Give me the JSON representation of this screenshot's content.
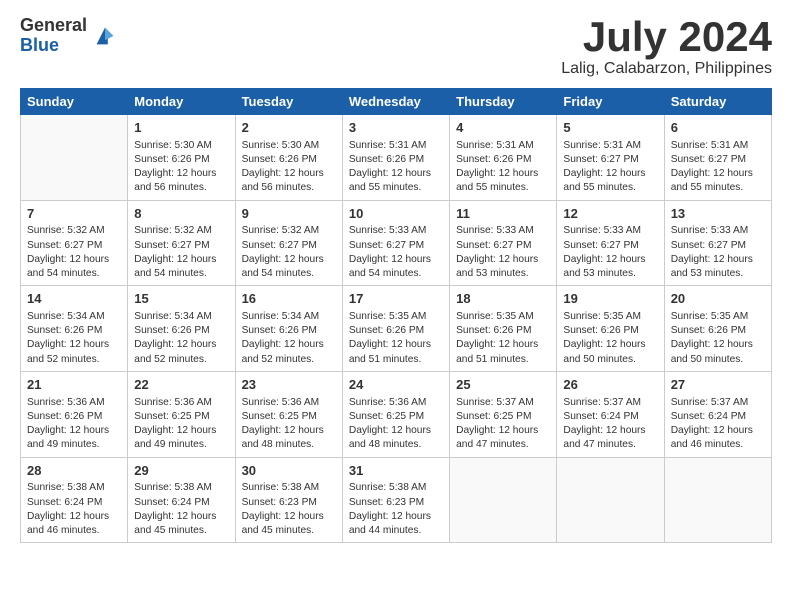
{
  "logo": {
    "general": "General",
    "blue": "Blue"
  },
  "title": "July 2024",
  "location": "Lalig, Calabarzon, Philippines",
  "headers": [
    "Sunday",
    "Monday",
    "Tuesday",
    "Wednesday",
    "Thursday",
    "Friday",
    "Saturday"
  ],
  "weeks": [
    [
      {
        "day": "",
        "info": ""
      },
      {
        "day": "1",
        "info": "Sunrise: 5:30 AM\nSunset: 6:26 PM\nDaylight: 12 hours\nand 56 minutes."
      },
      {
        "day": "2",
        "info": "Sunrise: 5:30 AM\nSunset: 6:26 PM\nDaylight: 12 hours\nand 56 minutes."
      },
      {
        "day": "3",
        "info": "Sunrise: 5:31 AM\nSunset: 6:26 PM\nDaylight: 12 hours\nand 55 minutes."
      },
      {
        "day": "4",
        "info": "Sunrise: 5:31 AM\nSunset: 6:26 PM\nDaylight: 12 hours\nand 55 minutes."
      },
      {
        "day": "5",
        "info": "Sunrise: 5:31 AM\nSunset: 6:27 PM\nDaylight: 12 hours\nand 55 minutes."
      },
      {
        "day": "6",
        "info": "Sunrise: 5:31 AM\nSunset: 6:27 PM\nDaylight: 12 hours\nand 55 minutes."
      }
    ],
    [
      {
        "day": "7",
        "info": "Sunrise: 5:32 AM\nSunset: 6:27 PM\nDaylight: 12 hours\nand 54 minutes."
      },
      {
        "day": "8",
        "info": "Sunrise: 5:32 AM\nSunset: 6:27 PM\nDaylight: 12 hours\nand 54 minutes."
      },
      {
        "day": "9",
        "info": "Sunrise: 5:32 AM\nSunset: 6:27 PM\nDaylight: 12 hours\nand 54 minutes."
      },
      {
        "day": "10",
        "info": "Sunrise: 5:33 AM\nSunset: 6:27 PM\nDaylight: 12 hours\nand 54 minutes."
      },
      {
        "day": "11",
        "info": "Sunrise: 5:33 AM\nSunset: 6:27 PM\nDaylight: 12 hours\nand 53 minutes."
      },
      {
        "day": "12",
        "info": "Sunrise: 5:33 AM\nSunset: 6:27 PM\nDaylight: 12 hours\nand 53 minutes."
      },
      {
        "day": "13",
        "info": "Sunrise: 5:33 AM\nSunset: 6:27 PM\nDaylight: 12 hours\nand 53 minutes."
      }
    ],
    [
      {
        "day": "14",
        "info": "Sunrise: 5:34 AM\nSunset: 6:26 PM\nDaylight: 12 hours\nand 52 minutes."
      },
      {
        "day": "15",
        "info": "Sunrise: 5:34 AM\nSunset: 6:26 PM\nDaylight: 12 hours\nand 52 minutes."
      },
      {
        "day": "16",
        "info": "Sunrise: 5:34 AM\nSunset: 6:26 PM\nDaylight: 12 hours\nand 52 minutes."
      },
      {
        "day": "17",
        "info": "Sunrise: 5:35 AM\nSunset: 6:26 PM\nDaylight: 12 hours\nand 51 minutes."
      },
      {
        "day": "18",
        "info": "Sunrise: 5:35 AM\nSunset: 6:26 PM\nDaylight: 12 hours\nand 51 minutes."
      },
      {
        "day": "19",
        "info": "Sunrise: 5:35 AM\nSunset: 6:26 PM\nDaylight: 12 hours\nand 50 minutes."
      },
      {
        "day": "20",
        "info": "Sunrise: 5:35 AM\nSunset: 6:26 PM\nDaylight: 12 hours\nand 50 minutes."
      }
    ],
    [
      {
        "day": "21",
        "info": "Sunrise: 5:36 AM\nSunset: 6:26 PM\nDaylight: 12 hours\nand 49 minutes."
      },
      {
        "day": "22",
        "info": "Sunrise: 5:36 AM\nSunset: 6:25 PM\nDaylight: 12 hours\nand 49 minutes."
      },
      {
        "day": "23",
        "info": "Sunrise: 5:36 AM\nSunset: 6:25 PM\nDaylight: 12 hours\nand 48 minutes."
      },
      {
        "day": "24",
        "info": "Sunrise: 5:36 AM\nSunset: 6:25 PM\nDaylight: 12 hours\nand 48 minutes."
      },
      {
        "day": "25",
        "info": "Sunrise: 5:37 AM\nSunset: 6:25 PM\nDaylight: 12 hours\nand 47 minutes."
      },
      {
        "day": "26",
        "info": "Sunrise: 5:37 AM\nSunset: 6:24 PM\nDaylight: 12 hours\nand 47 minutes."
      },
      {
        "day": "27",
        "info": "Sunrise: 5:37 AM\nSunset: 6:24 PM\nDaylight: 12 hours\nand 46 minutes."
      }
    ],
    [
      {
        "day": "28",
        "info": "Sunrise: 5:38 AM\nSunset: 6:24 PM\nDaylight: 12 hours\nand 46 minutes."
      },
      {
        "day": "29",
        "info": "Sunrise: 5:38 AM\nSunset: 6:24 PM\nDaylight: 12 hours\nand 45 minutes."
      },
      {
        "day": "30",
        "info": "Sunrise: 5:38 AM\nSunset: 6:23 PM\nDaylight: 12 hours\nand 45 minutes."
      },
      {
        "day": "31",
        "info": "Sunrise: 5:38 AM\nSunset: 6:23 PM\nDaylight: 12 hours\nand 44 minutes."
      },
      {
        "day": "",
        "info": ""
      },
      {
        "day": "",
        "info": ""
      },
      {
        "day": "",
        "info": ""
      }
    ]
  ]
}
